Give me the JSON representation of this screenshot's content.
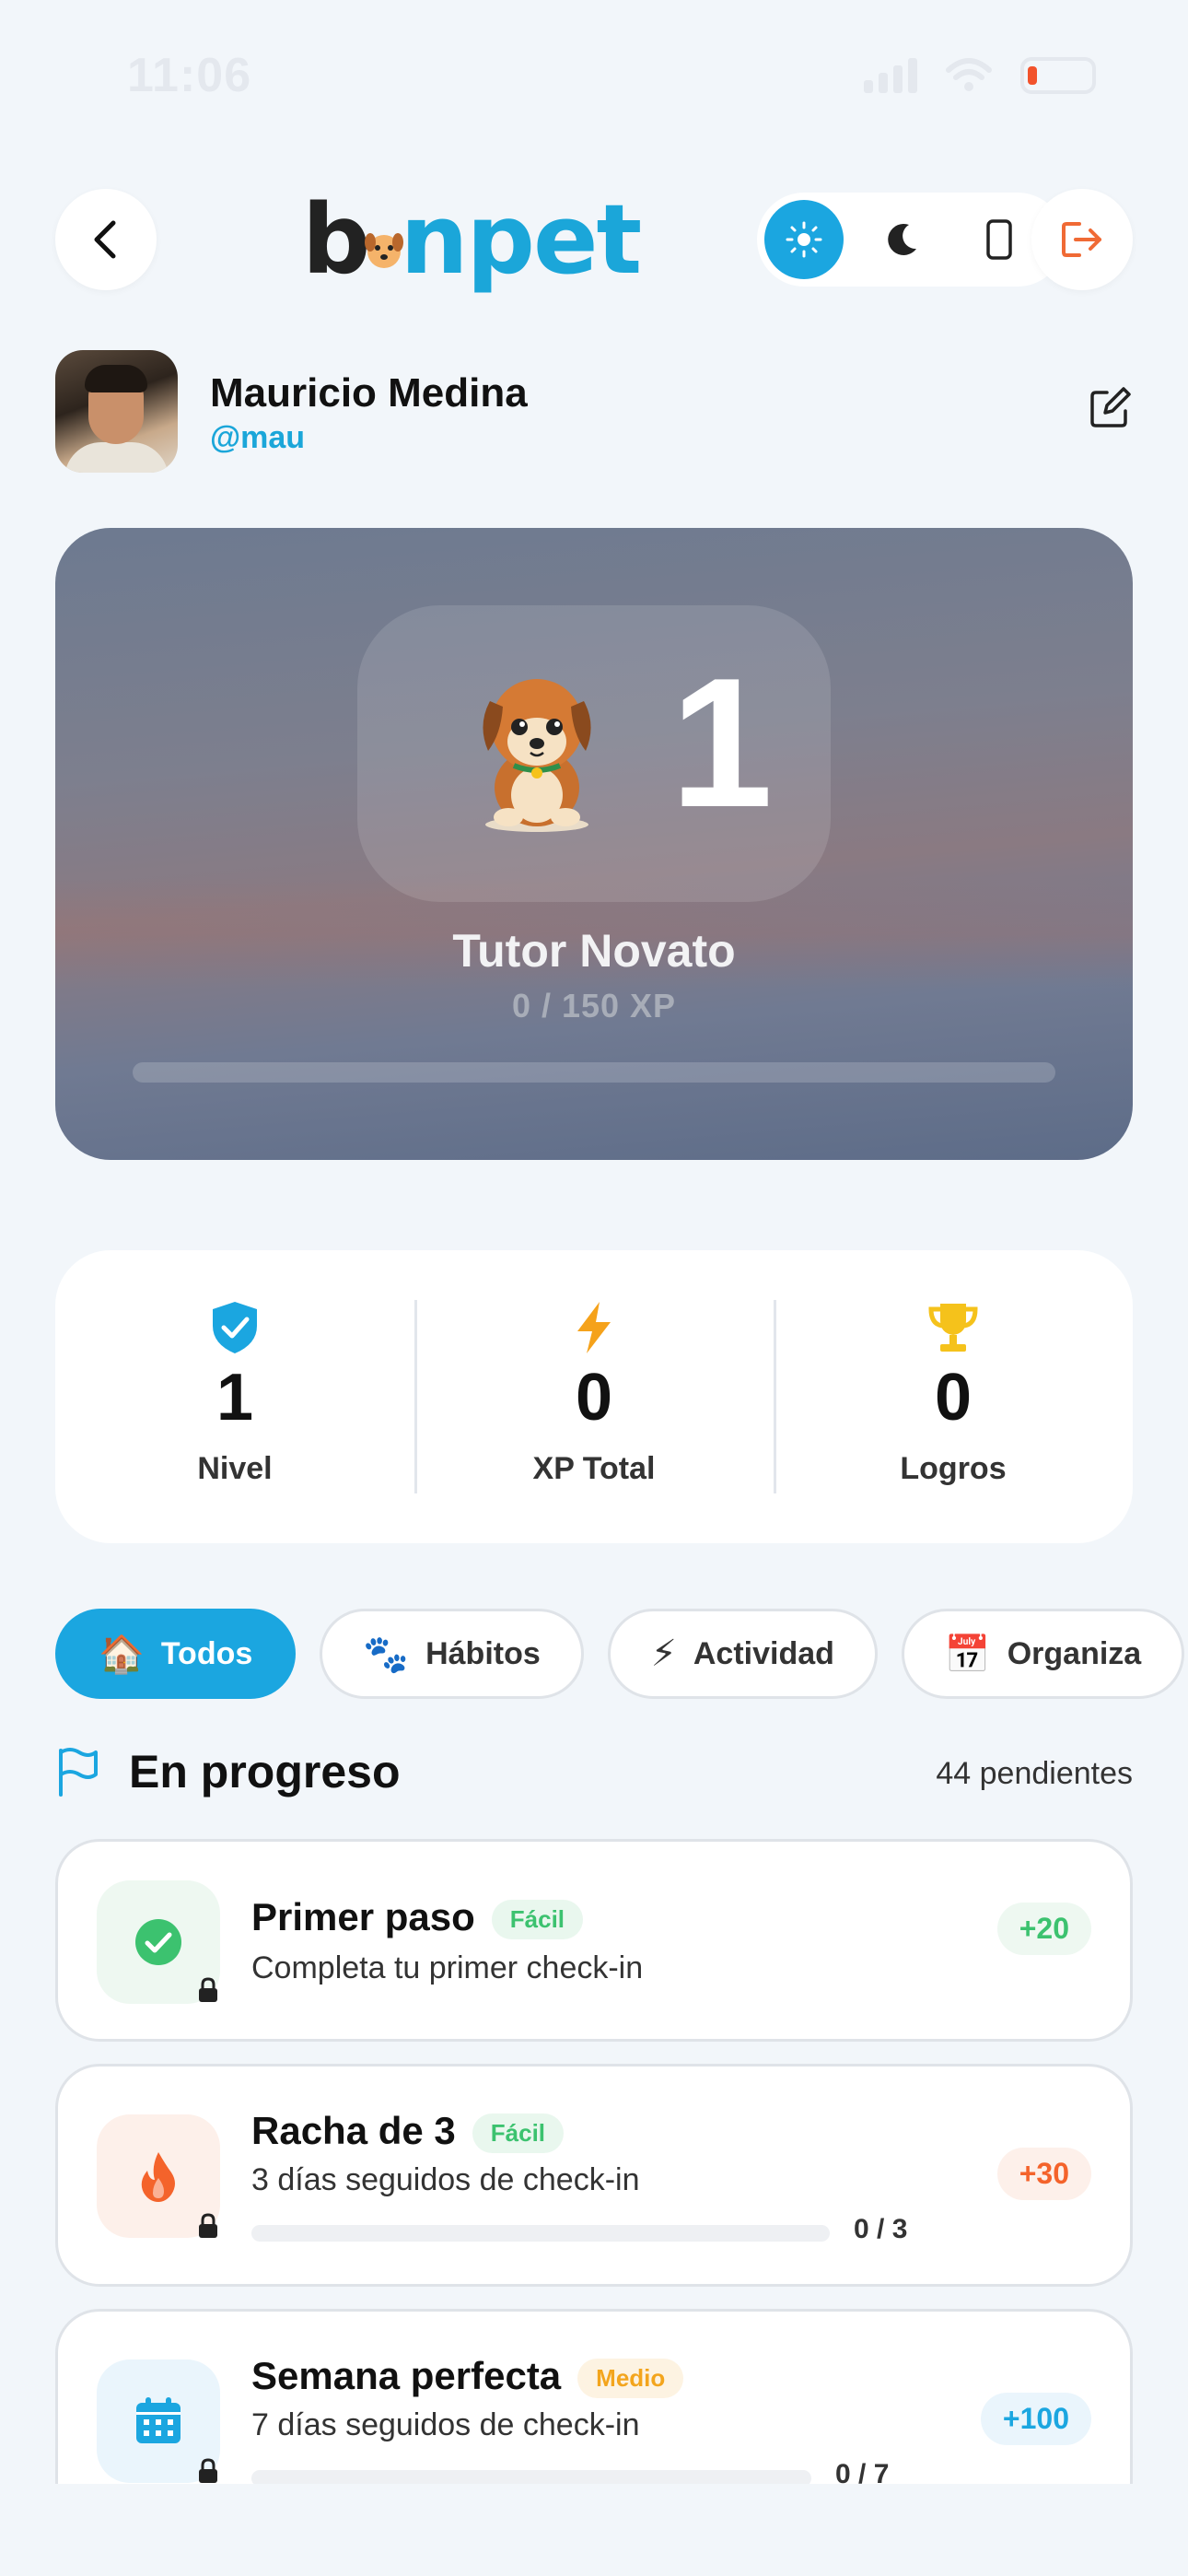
{
  "status_bar": {
    "time": "11:06"
  },
  "header": {
    "logo_text": "binpet",
    "logo_text_b": "b",
    "logo_text_rest": "npet"
  },
  "profile": {
    "name": "Mauricio Medina",
    "handle": "@mau"
  },
  "level_card": {
    "level": "1",
    "title": "Tutor Novato",
    "xp_text": "0 / 150 XP",
    "xp_progress": 0
  },
  "stats": [
    {
      "value": "1",
      "label": "Nivel",
      "icon": "shield-check-icon",
      "color": "#1ba6e0"
    },
    {
      "value": "0",
      "label": "XP Total",
      "icon": "lightning-icon",
      "color": "#f5a21b"
    },
    {
      "value": "0",
      "label": "Logros",
      "icon": "trophy-icon",
      "color": "#f5c21b"
    }
  ],
  "filters": [
    {
      "label": "Todos",
      "emoji": "🏠",
      "active": true
    },
    {
      "label": "Hábitos",
      "emoji": "🐾",
      "active": false
    },
    {
      "label": "Actividad",
      "emoji": "⚡",
      "active": false
    },
    {
      "label": "Organiza",
      "emoji": "📅",
      "active": false
    }
  ],
  "section": {
    "title": "En progreso",
    "count": "44 pendientes"
  },
  "achievements": [
    {
      "title": "Primer paso",
      "tag": "Fácil",
      "desc": "Completa tu primer check-in",
      "xp": "+20",
      "icon": "check-circle-icon",
      "progress_text": "",
      "progress": 0
    },
    {
      "title": "Racha de 3",
      "tag": "Fácil",
      "desc": "3 días seguidos de check-in",
      "xp": "+30",
      "icon": "flame-icon",
      "progress_text": "0 / 3",
      "progress": 0
    },
    {
      "title": "Semana perfecta",
      "tag": "Medio",
      "desc": "7 días seguidos de check-in",
      "xp": "+100",
      "icon": "calendar-icon",
      "progress_text": "0 / 7",
      "progress": 0
    }
  ]
}
